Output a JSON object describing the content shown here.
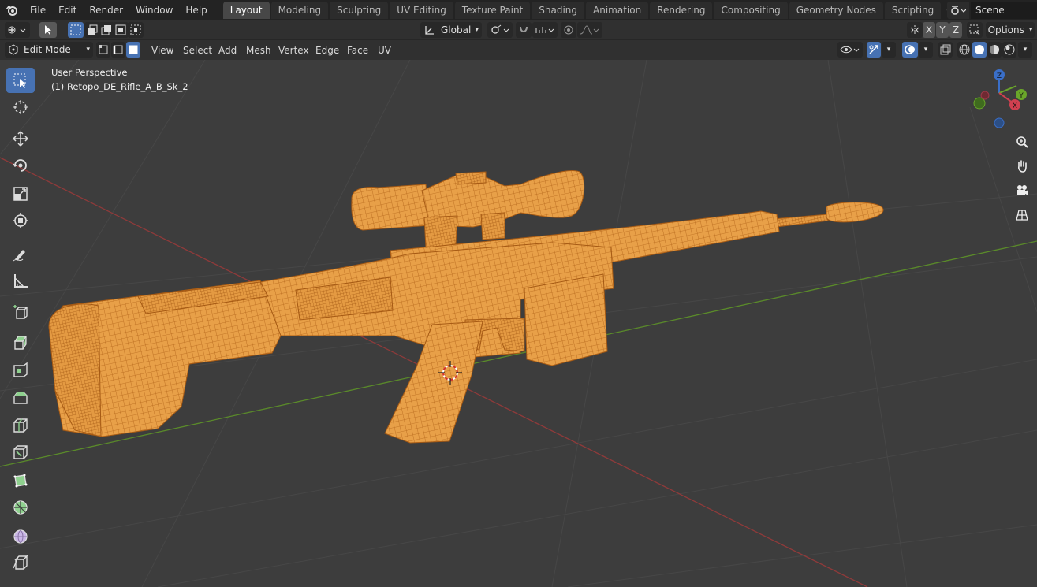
{
  "menu": [
    "File",
    "Edit",
    "Render",
    "Window",
    "Help"
  ],
  "workspaces": [
    {
      "label": "Layout",
      "active": true
    },
    {
      "label": "Modeling",
      "active": false
    },
    {
      "label": "Sculpting",
      "active": false
    },
    {
      "label": "UV Editing",
      "active": false
    },
    {
      "label": "Texture Paint",
      "active": false
    },
    {
      "label": "Shading",
      "active": false
    },
    {
      "label": "Animation",
      "active": false
    },
    {
      "label": "Rendering",
      "active": false
    },
    {
      "label": "Compositing",
      "active": false
    },
    {
      "label": "Geometry Nodes",
      "active": false
    },
    {
      "label": "Scripting",
      "active": false
    }
  ],
  "scene": {
    "name": "Scene"
  },
  "tool_header": {
    "transform_orientation": "Global",
    "axes": [
      "X",
      "Y",
      "Z"
    ],
    "options_label": "Options"
  },
  "view_header": {
    "mode": "Edit Mode",
    "menus": [
      "View",
      "Select",
      "Add",
      "Mesh",
      "Vertex",
      "Edge",
      "Face",
      "UV"
    ]
  },
  "viewport": {
    "perspective_label": "User Perspective",
    "object_label": "(1) Retopo_DE_Rifle_A_B_Sk_2"
  },
  "gizmo": {
    "x": "X",
    "y": "Y",
    "z": "Z"
  },
  "colors": {
    "accent": "#4772b3",
    "mesh": "#e8a048",
    "wire": "#b5661a",
    "x_axis": "#8f3a3a",
    "y_axis": "#5a8a2a",
    "background": "#3d3d3d"
  },
  "toolbar_icons": [
    "select-box-icon",
    "cursor-icon",
    "move-icon",
    "rotate-icon",
    "scale-icon",
    "transform-icon",
    "annotate-icon",
    "measure-icon",
    "add-cube-icon",
    "extrude-icon",
    "inset-icon",
    "bevel-icon",
    "loop-cut-icon",
    "knife-icon",
    "poly-build-icon",
    "spin-icon",
    "smooth-icon",
    "shear-icon"
  ]
}
